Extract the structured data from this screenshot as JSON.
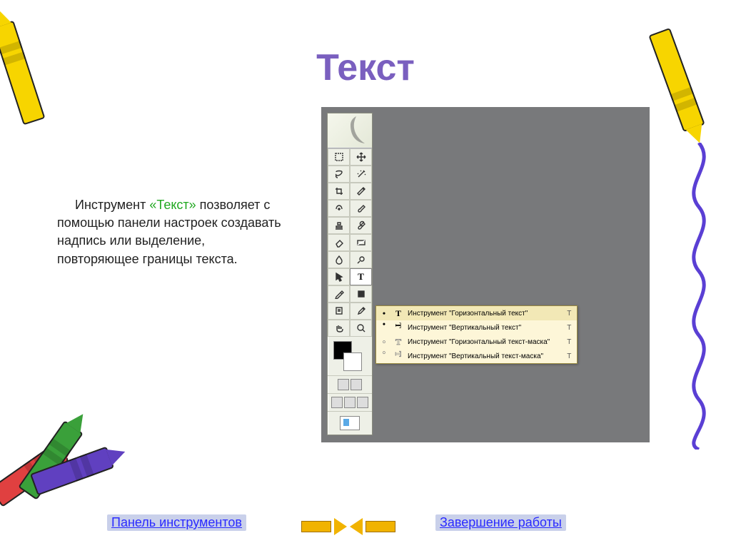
{
  "title": "Текст",
  "paragraph": {
    "prefix": "Инструмент ",
    "keyword": "«Текст»",
    "suffix": " позволяет с помощью панели настроек создавать надпись или выделение, повторяющее границы текста."
  },
  "nav": {
    "left": "Панель инструментов",
    "right": "Завершение работы"
  },
  "toolbox_rows": [
    [
      "rect-marquee",
      "move"
    ],
    [
      "lasso",
      "magic-wand"
    ],
    [
      "crop",
      "slice"
    ],
    [
      "healing",
      "brush"
    ],
    [
      "stamp",
      "history-brush"
    ],
    [
      "eraser",
      "gradient"
    ],
    [
      "blur",
      "dodge"
    ],
    [
      "path-select",
      "type"
    ],
    [
      "pen",
      "shape"
    ],
    [
      "notes",
      "eyedropper"
    ],
    [
      "hand",
      "zoom"
    ]
  ],
  "selected_tool": "type",
  "flyout": {
    "items": [
      {
        "icon": "T",
        "style": "solid",
        "label": "Инструмент \"Горизонтальный текст\"",
        "sc": "T",
        "sel": true
      },
      {
        "icon": "T",
        "style": "solid rot",
        "label": "Инструмент \"Вертикальный текст\"",
        "sc": "T",
        "sel": false
      },
      {
        "icon": "T",
        "style": "mask",
        "label": "Инструмент \"Горизонтальный текст-маска\"",
        "sc": "T",
        "sel": false
      },
      {
        "icon": "T",
        "style": "mask rot",
        "label": "Инструмент \"Вертикальный текст-маска\"",
        "sc": "T",
        "sel": false
      }
    ]
  }
}
